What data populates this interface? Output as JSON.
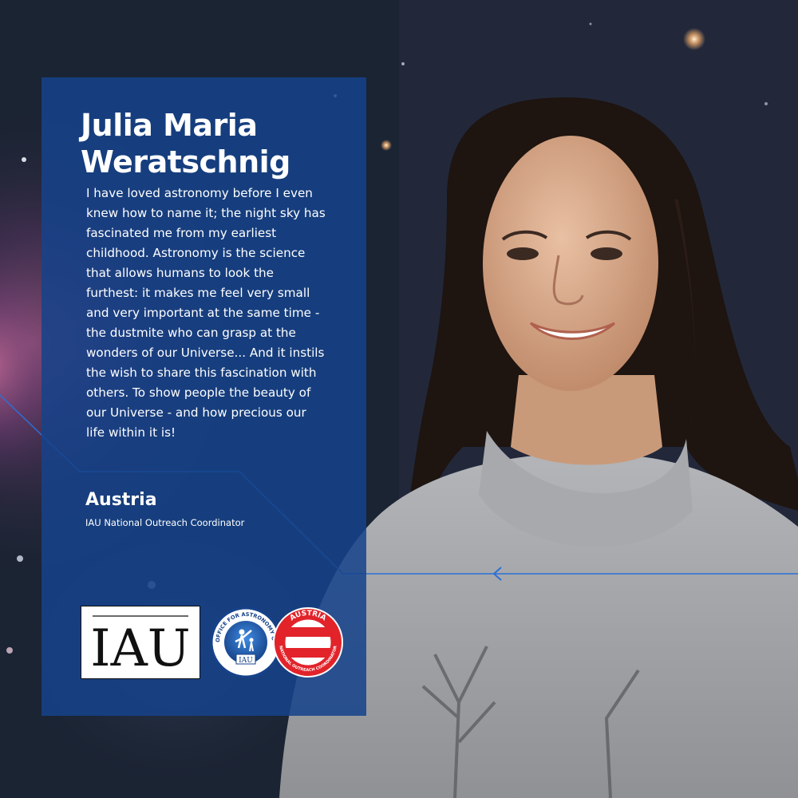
{
  "person": {
    "name": "Julia Maria Weratschnig",
    "quote": "I have loved astronomy before I even knew how to name it; the night sky has fascinated me from my earliest childhood. Astronomy is the science that allows humans to look the furthest: it makes me feel very small and very important at the same time - the dustmite who can grasp at the wonders of our Universe... And it instils the wish to share this fascination with others. To show people the beauty of our Universe - and how precious our life within it is!",
    "country": "Austria",
    "role": "IAU National Outreach Coordinator"
  },
  "logos": {
    "iau": "IAU",
    "outreach_ring_text": "OFFICE FOR ASTRONOMY OUTREACH",
    "outreach_badge": "IAU",
    "austria_top": "AUSTRIA",
    "austria_bottom": "NATIONAL OUTREACH COORDINATOR"
  },
  "colors": {
    "card": "#16428a",
    "line": "#2d6fd6",
    "background": "#1b2433",
    "sweater": "#9fa1a5",
    "hair": "#1e1410",
    "austria_red": "#e2232a"
  }
}
